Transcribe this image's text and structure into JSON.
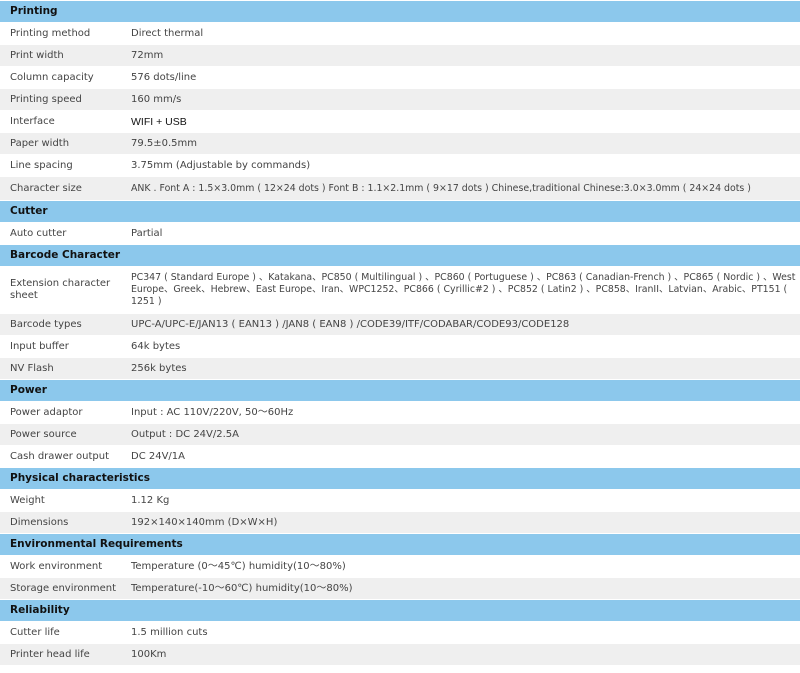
{
  "sections": [
    {
      "title": "Printing",
      "rows": [
        {
          "label": "Printing method",
          "value": "Direct thermal"
        },
        {
          "label": "Print width",
          "value": "72mm"
        },
        {
          "label": "Column capacity",
          "value": "576 dots/line"
        },
        {
          "label": "Printing speed",
          "value": "160 mm/s"
        },
        {
          "label": "Interface",
          "value": "WIFI + USB"
        },
        {
          "label": "Paper width",
          "value": "79.5±0.5mm"
        },
        {
          "label": "Line spacing",
          "value": "3.75mm (Adjustable by commands)"
        },
        {
          "label": "Character size",
          "value": "ANK . Font A : 1.5×3.0mm ( 12×24 dots )  Font B : 1.1×2.1mm ( 9×17 dots )  Chinese,traditional Chinese:3.0×3.0mm ( 24×24 dots )"
        }
      ]
    },
    {
      "title": "Cutter",
      "rows": [
        {
          "label": "Auto cutter",
          "value": "Partial"
        }
      ]
    },
    {
      "title": "Barcode Character",
      "rows": [
        {
          "label": "Extension character sheet",
          "value": "PC347 ( Standard Europe ) 、Katakana、PC850 ( Multilingual ) 、PC860 ( Portuguese ) 、PC863 ( Canadian-French ) 、PC865 ( Nordic ) 、West Europe、Greek、Hebrew、East Europe、Iran、WPC1252、PC866 ( Cyrillic#2 ) 、PC852 ( Latin2 ) 、PC858、IranII、Latvian、Arabic、PT151 ( 1251 )"
        },
        {
          "label": "Barcode types",
          "value": "UPC-A/UPC-E/JAN13 ( EAN13 ) /JAN8 ( EAN8 ) /CODE39/ITF/CODABAR/CODE93/CODE128"
        },
        {
          "label": "Input buffer",
          "value": "64k bytes"
        },
        {
          "label": "NV Flash",
          "value": "256k bytes"
        }
      ]
    },
    {
      "title": "Power",
      "rows": [
        {
          "label": "Power adaptor",
          "value": "Input : AC 110V/220V, 50～60Hz"
        },
        {
          "label": "Power source",
          "value": "Output : DC 24V/2.5A"
        },
        {
          "label": "Cash drawer output",
          "value": "DC 24V/1A"
        }
      ]
    },
    {
      "title": "Physical characteristics",
      "rows": [
        {
          "label": "Weight",
          "value": "1.12 Kg"
        },
        {
          "label": "Dimensions",
          "value": "192×140×140mm (D×W×H)"
        }
      ]
    },
    {
      "title": "Environmental Requirements",
      "rows": [
        {
          "label": "Work environment",
          "value": "Temperature (0～45℃)  humidity(10～80%)"
        },
        {
          "label": "Storage environment",
          "value": "Temperature(-10～60℃) humidity(10～80%)"
        }
      ]
    },
    {
      "title": "Reliability",
      "rows": [
        {
          "label": "Cutter life",
          "value": "1.5 million cuts"
        },
        {
          "label": "Printer head life",
          "value": "100Km"
        }
      ]
    }
  ]
}
